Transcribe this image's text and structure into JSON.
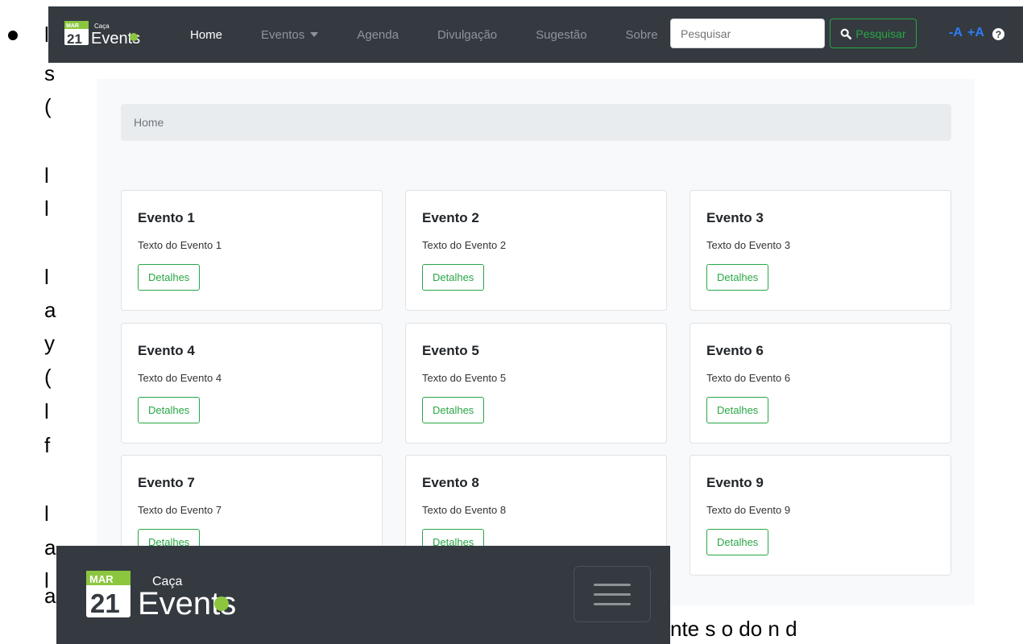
{
  "document": {
    "fragments": [
      "l",
      "s",
      "(",
      "l",
      "l",
      "l",
      "a",
      "y",
      "(",
      "l",
      "f",
      "l",
      "a",
      "l",
      "a"
    ],
    "trailing_fragment": "  nte s o do n d"
  },
  "navbar": {
    "brand_month": "MAR",
    "brand_day": "21",
    "brand_small": "Caça",
    "brand_name": "Events",
    "links": [
      {
        "label": "Home",
        "active": true
      },
      {
        "label": "Eventos",
        "active": false,
        "dropdown": true
      },
      {
        "label": "Agenda",
        "active": false
      },
      {
        "label": "Divulgação",
        "active": false
      },
      {
        "label": "Sugestão",
        "active": false
      },
      {
        "label": "Sobre",
        "active": false
      }
    ],
    "search_placeholder": "Pesquisar",
    "search_button": "Pesquisar",
    "font_decrease": "-A",
    "font_increase": "+A",
    "help": "?"
  },
  "breadcrumb": {
    "label": "Home"
  },
  "cards": [
    {
      "title": "Evento 1",
      "text": "Texto do Evento 1",
      "button": "Detalhes"
    },
    {
      "title": "Evento 2",
      "text": "Texto do Evento 2",
      "button": "Detalhes"
    },
    {
      "title": "Evento 3",
      "text": "Texto do Evento 3",
      "button": "Detalhes"
    },
    {
      "title": "Evento 4",
      "text": "Texto do Evento 4",
      "button": "Detalhes"
    },
    {
      "title": "Evento 5",
      "text": "Texto do Evento 5",
      "button": "Detalhes"
    },
    {
      "title": "Evento 6",
      "text": "Texto do Evento 6",
      "button": "Detalhes"
    },
    {
      "title": "Evento 7",
      "text": "Texto do Evento 7",
      "button": "Detalhes"
    },
    {
      "title": "Evento 8",
      "text": "Texto do Evento 8",
      "button": "Detalhes"
    },
    {
      "title": "Evento 9",
      "text": "Texto do Evento 9",
      "button": "Detalhes"
    }
  ],
  "mobile": {
    "brand_month": "MAR",
    "brand_day": "21",
    "brand_small": "Caça",
    "brand_name": "Events"
  },
  "colors": {
    "navbar_bg": "#343a40",
    "accent_green": "#28a745",
    "font_ctrl_blue": "#2f7bf5",
    "page_bg": "#f8f9fa"
  },
  "icons": [
    "calendar-logo-icon",
    "magnifier-icon",
    "search-icon",
    "caret-down-icon",
    "help-icon",
    "hamburger-icon"
  ]
}
